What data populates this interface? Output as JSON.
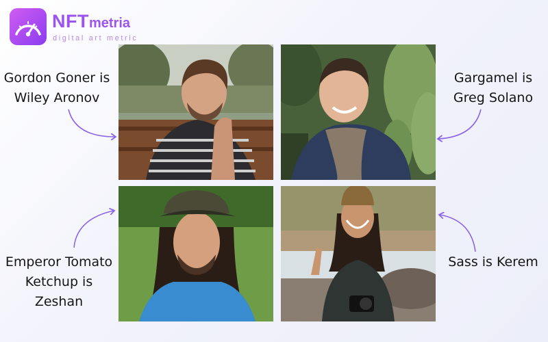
{
  "logo": {
    "brand_prefix": "NFT",
    "brand_suffix": "metria",
    "tagline": "digital art metric",
    "icon": "speedometer-icon",
    "colors": {
      "start": "#d05cf2",
      "end": "#8a3df0",
      "text": "#9c53f0"
    }
  },
  "captions": {
    "top_left": [
      "Gordon Goner is",
      "Wiley Aronov"
    ],
    "top_right": [
      "Gargamel is",
      "Greg Solano"
    ],
    "bottom_left": [
      "Emperor Tomato",
      "Ketchup is",
      "Zeshan"
    ],
    "bottom_right": [
      "Sass is Kerem"
    ]
  },
  "colors": {
    "arrow": "#8a63e8",
    "caption": "#151515"
  }
}
